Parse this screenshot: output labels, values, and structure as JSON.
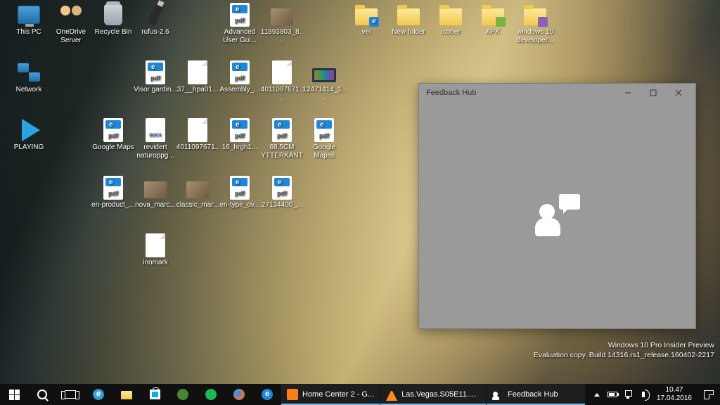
{
  "desktop_icons": [
    {
      "row": 0,
      "col": 0,
      "type": "pc",
      "label": "This PC"
    },
    {
      "row": 0,
      "col": 1,
      "type": "people",
      "label": "OneDrive Server"
    },
    {
      "row": 0,
      "col": 2,
      "type": "bin",
      "label": "Recycle Bin"
    },
    {
      "row": 0,
      "col": 3,
      "type": "usb",
      "label": "rufus-2.6"
    },
    {
      "row": 0,
      "col": 5,
      "type": "pdf",
      "label": "Advanced User Gui..."
    },
    {
      "row": 0,
      "col": 6,
      "type": "img",
      "label": "11893803_8..."
    },
    {
      "row": 0,
      "col": 8,
      "type": "folder-edge",
      "label": "vei"
    },
    {
      "row": 0,
      "col": 9,
      "type": "folder",
      "label": "New folder"
    },
    {
      "row": 0,
      "col": 10,
      "type": "folder",
      "label": "iconer"
    },
    {
      "row": 0,
      "col": 11,
      "type": "folder-apk",
      "label": "APK"
    },
    {
      "row": 0,
      "col": 12,
      "type": "folder-vs",
      "label": "windows 10 developer..."
    },
    {
      "row": 1,
      "col": 0,
      "type": "net",
      "label": "Network"
    },
    {
      "row": 1,
      "col": 3,
      "type": "pdf",
      "label": "Visor gardin..."
    },
    {
      "row": 1,
      "col": 4,
      "type": "doc",
      "label": "37__hpa01..."
    },
    {
      "row": 1,
      "col": 5,
      "type": "pdf",
      "label": "Assembly_..."
    },
    {
      "row": 1,
      "col": 6,
      "type": "doc",
      "label": "4011097671..."
    },
    {
      "row": 1,
      "col": 7,
      "type": "nxm",
      "label": "12471414_1..."
    },
    {
      "row": 2,
      "col": 0,
      "type": "play",
      "label": "PLAYING"
    },
    {
      "row": 2,
      "col": 2,
      "type": "pdf",
      "label": "Google Maps"
    },
    {
      "row": 2,
      "col": 3,
      "type": "docx",
      "label": "revidert naturoppg..."
    },
    {
      "row": 2,
      "col": 4,
      "type": "doc",
      "label": "4011097671..."
    },
    {
      "row": 2,
      "col": 5,
      "type": "pdf",
      "label": "16_hrgh1..."
    },
    {
      "row": 2,
      "col": 6,
      "type": "pdf",
      "label": "68,5CM YTTERKANT"
    },
    {
      "row": 2,
      "col": 7,
      "type": "pdf",
      "label": "Google Mapss"
    },
    {
      "row": 3,
      "col": 2,
      "type": "pdf",
      "label": "en-product_..."
    },
    {
      "row": 3,
      "col": 3,
      "type": "img",
      "label": "nova_marc..."
    },
    {
      "row": 3,
      "col": 4,
      "type": "img",
      "label": "classic_mar..."
    },
    {
      "row": 3,
      "col": 5,
      "type": "pdf",
      "label": "en-type_ov..."
    },
    {
      "row": 3,
      "col": 6,
      "type": "pdf",
      "label": "27134400_..."
    },
    {
      "row": 4,
      "col": 3,
      "type": "doc",
      "label": "innmark"
    }
  ],
  "window": {
    "title": "Feedback Hub"
  },
  "watermark": {
    "line1": "Windows 10 Pro Insider Preview",
    "line2": "Evaluation copy. Build 14316.rs1_release.160402-2217"
  },
  "taskbar": {
    "tasks": [
      {
        "icon": "home",
        "label": "Home Center 2 - G..."
      },
      {
        "icon": "vlc",
        "label": "Las.Vegas.S05E11.A..."
      },
      {
        "icon": "fb",
        "label": "Feedback Hub"
      }
    ],
    "time": "10.47",
    "date": "17.04.2016"
  }
}
